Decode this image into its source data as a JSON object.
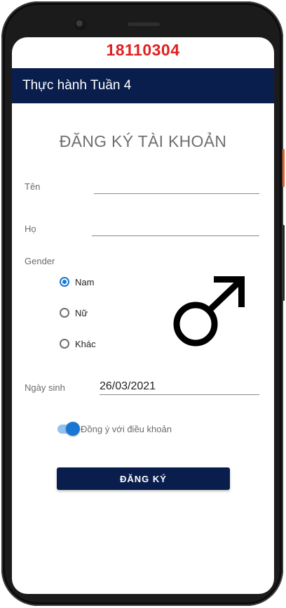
{
  "header": {
    "student_id": "18110304",
    "app_title": "Thực hành Tuần 4"
  },
  "form": {
    "title": "ĐĂNG KÝ TÀI KHOẢN",
    "first_name_label": "Tên",
    "first_name_value": "",
    "last_name_label": "Họ",
    "last_name_value": "",
    "gender_label": "Gender",
    "gender_options": [
      "Nam",
      "Nữ",
      "Khác"
    ],
    "gender_selected": "Nam",
    "gender_symbol": "male-symbol-icon",
    "dob_label": "Ngày sinh",
    "dob_value": "26/03/2021",
    "terms_label": "Đồng ý với điều khoản",
    "terms_switch_on": true,
    "submit_label": "ĐĂNG KÝ"
  },
  "colors": {
    "app_bar": "#0a1e4e",
    "accent": "#1976d2",
    "student_id": "#e02020"
  }
}
